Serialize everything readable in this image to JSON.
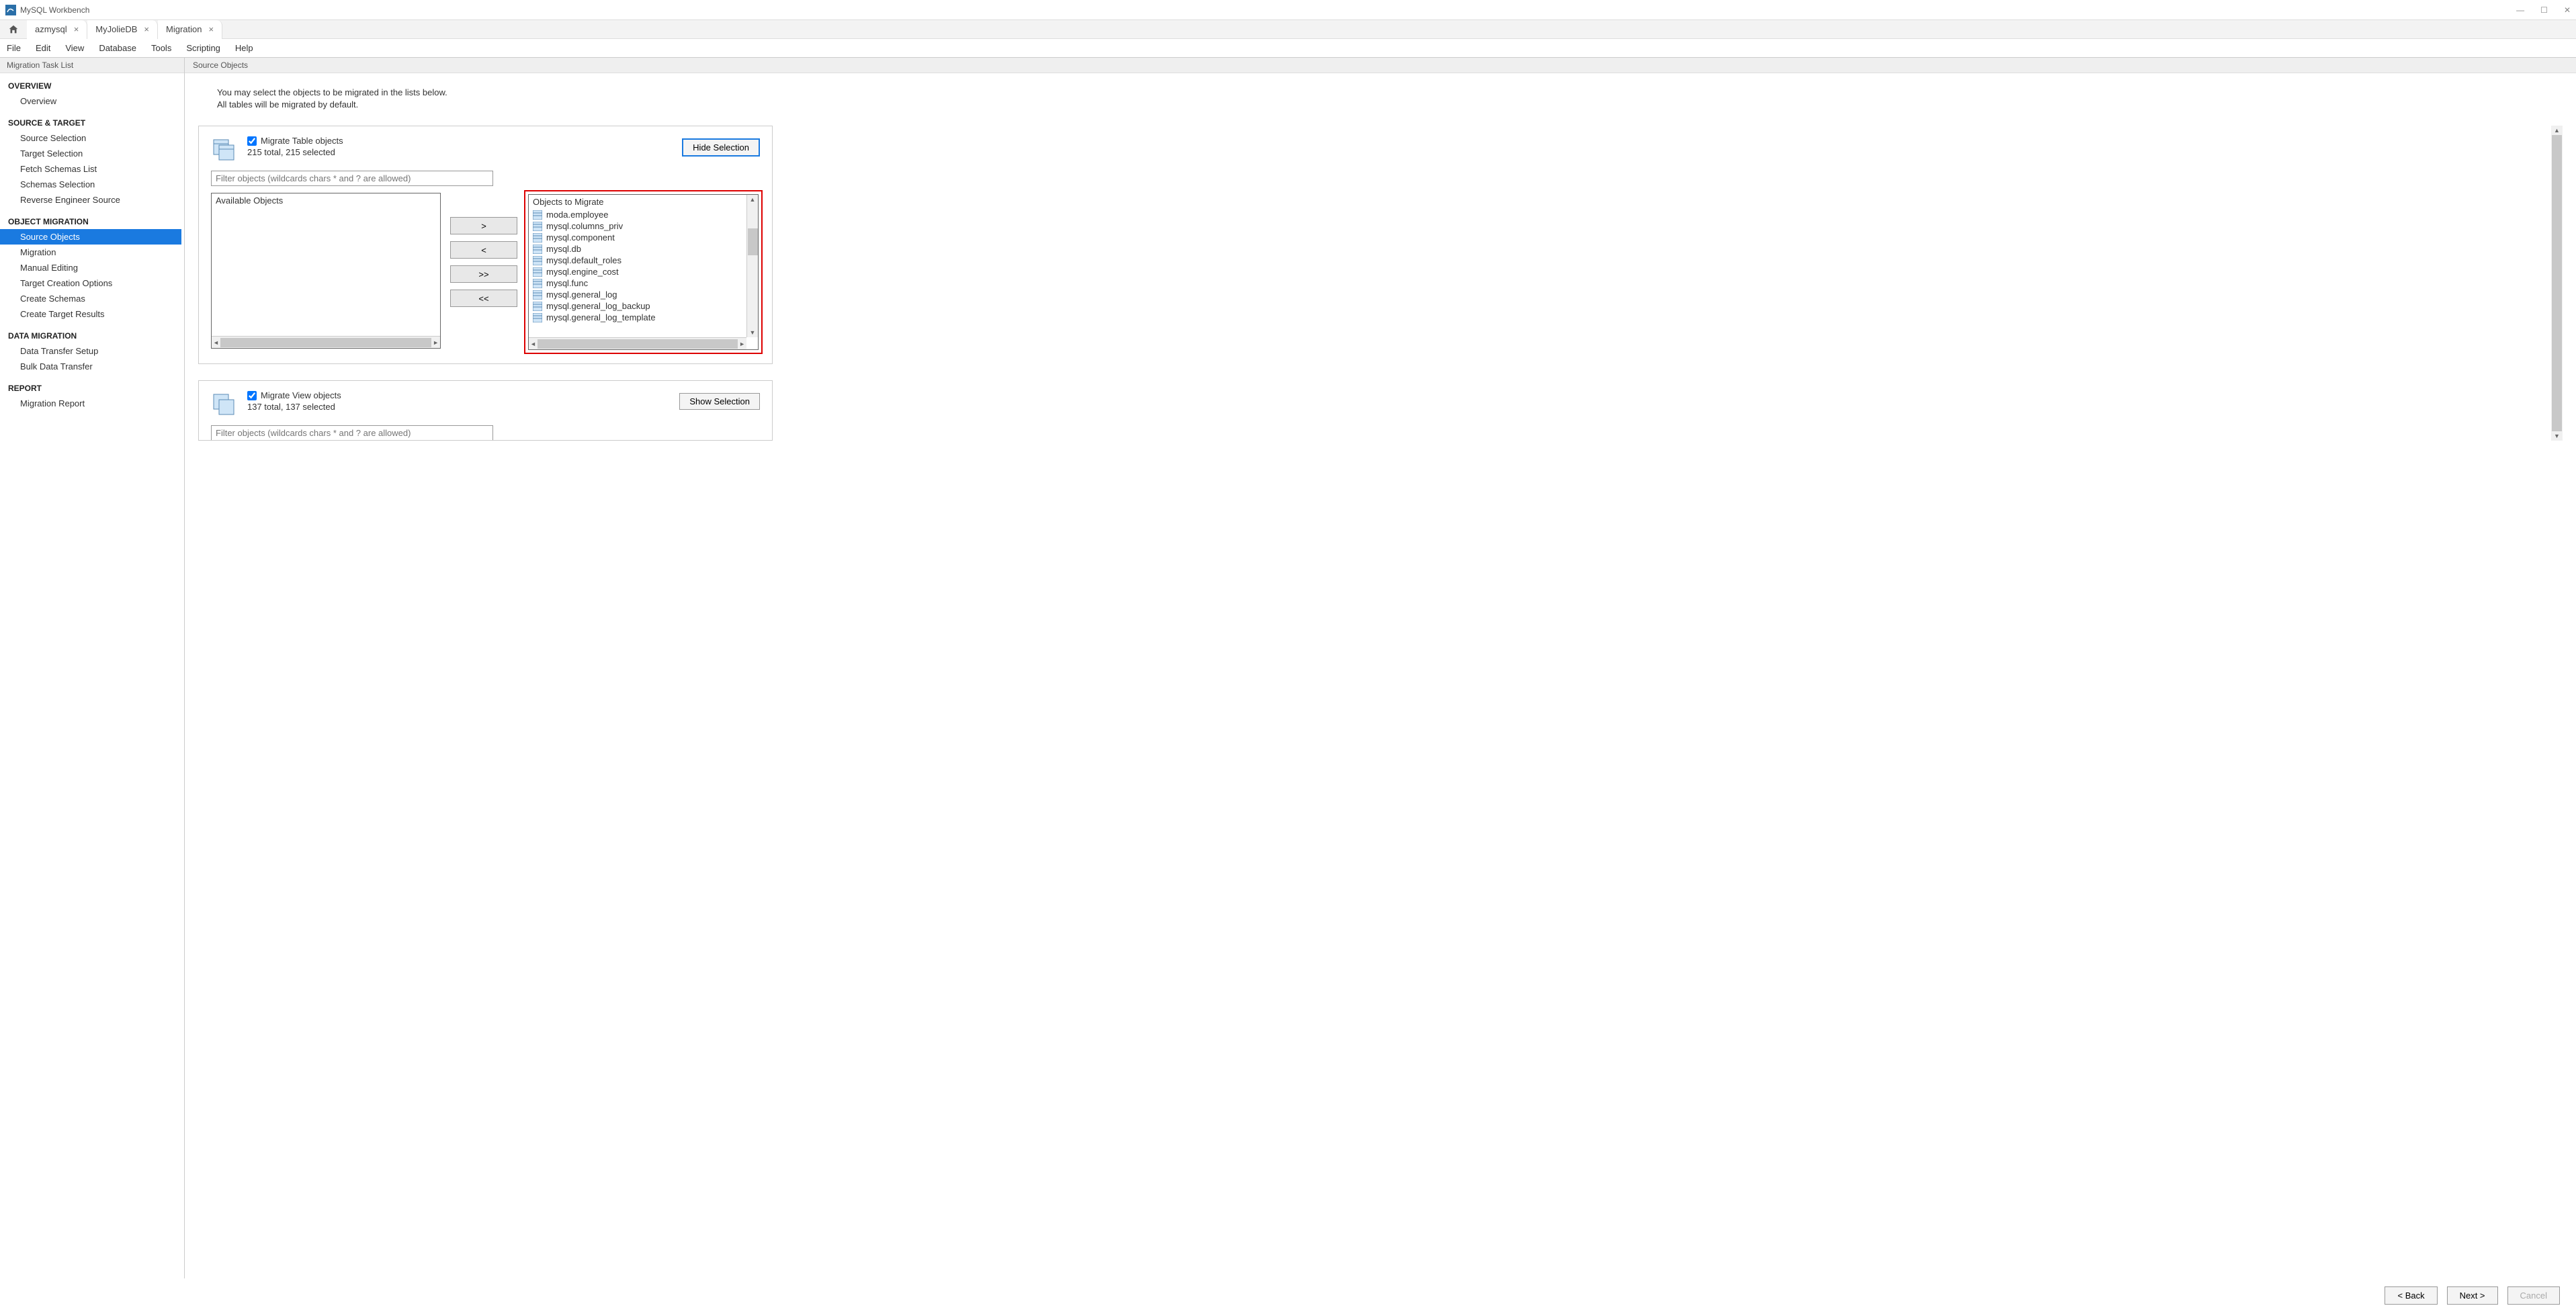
{
  "window": {
    "title": "MySQL Workbench"
  },
  "tabs": [
    {
      "label": "azmysql"
    },
    {
      "label": "MyJolieDB"
    },
    {
      "label": "Migration"
    }
  ],
  "menu": [
    "File",
    "Edit",
    "View",
    "Database",
    "Tools",
    "Scripting",
    "Help"
  ],
  "sidebar": {
    "header": "Migration Task List",
    "sections": [
      {
        "heading": "OVERVIEW",
        "items": [
          "Overview"
        ]
      },
      {
        "heading": "SOURCE & TARGET",
        "items": [
          "Source Selection",
          "Target Selection",
          "Fetch Schemas List",
          "Schemas Selection",
          "Reverse Engineer Source"
        ]
      },
      {
        "heading": "OBJECT MIGRATION",
        "items": [
          "Source Objects",
          "Migration",
          "Manual Editing",
          "Target Creation Options",
          "Create Schemas",
          "Create Target Results"
        ]
      },
      {
        "heading": "DATA MIGRATION",
        "items": [
          "Data Transfer Setup",
          "Bulk Data Transfer"
        ]
      },
      {
        "heading": "REPORT",
        "items": [
          "Migration Report"
        ]
      }
    ],
    "active": "Source Objects"
  },
  "content": {
    "header": "Source Objects",
    "intro1": "You may select the objects to be migrated in the lists below.",
    "intro2": "All tables will be migrated by default.",
    "tablePanel": {
      "checkboxLabel": "Migrate Table objects",
      "subtext": "215 total, 215 selected",
      "hideBtn": "Hide Selection",
      "filterPlaceholder": "Filter objects (wildcards chars * and ? are allowed)",
      "availableHeader": "Available Objects",
      "migrateHeader": "Objects to Migrate",
      "objectsToMigrate": [
        "moda.employee",
        "mysql.columns_priv",
        "mysql.component",
        "mysql.db",
        "mysql.default_roles",
        "mysql.engine_cost",
        "mysql.func",
        "mysql.general_log",
        "mysql.general_log_backup",
        "mysql.general_log_template"
      ],
      "transferBtns": {
        "right": ">",
        "left": "<",
        "allRight": ">>",
        "allLeft": "<<"
      }
    },
    "viewPanel": {
      "checkboxLabel": "Migrate View objects",
      "subtext": "137 total, 137 selected",
      "showBtn": "Show Selection",
      "filterPlaceholder": "Filter objects (wildcards chars * and ? are allowed)"
    }
  },
  "footer": {
    "back": "< Back",
    "next": "Next >",
    "cancel": "Cancel"
  }
}
